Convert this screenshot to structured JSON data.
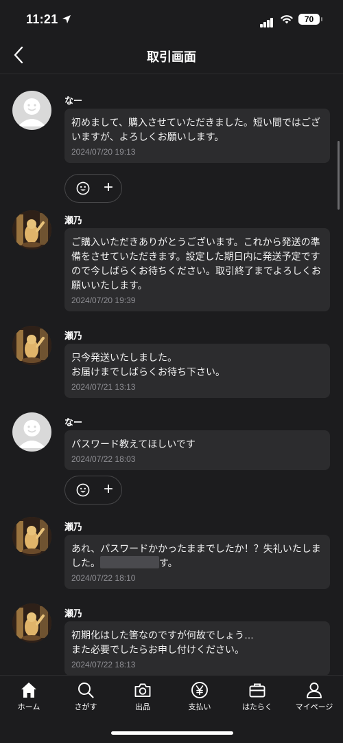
{
  "status_bar": {
    "time": "11:21",
    "battery": "70"
  },
  "header": {
    "title": "取引画面"
  },
  "messages": [
    {
      "sender": "なー",
      "avatar": "default-avatar",
      "text": "初めまして、購入させていただきました。短い間ではございますが、よろしくお願いします。",
      "timestamp": "2024/07/20 19:13"
    },
    {
      "sender": "瀬乃",
      "avatar": "photo-avatar",
      "text": "ご購入いただきありがとうございます。これから発送の準備をさせていただきます。設定した期日内に発送予定ですので今しばらくお待ちください。取引終了までよろしくお願いいたします。",
      "timestamp": "2024/07/20 19:39"
    },
    {
      "sender": "瀬乃",
      "avatar": "photo-avatar",
      "text": "只今発送いたしました。\nお届けまでしばらくお待ち下さい。",
      "timestamp": "2024/07/21 13:13"
    },
    {
      "sender": "なー",
      "avatar": "default-avatar",
      "text": "パスワード教えてほしいです",
      "timestamp": "2024/07/22 18:03"
    },
    {
      "sender": "瀬乃",
      "avatar": "photo-avatar",
      "text_before": "あれ、パスワードかかったままでしたか！？失礼いたしました。",
      "text_after": "す。",
      "timestamp": "2024/07/22 18:10"
    },
    {
      "sender": "瀬乃",
      "avatar": "photo-avatar",
      "text": "初期化はした筈なのですが何故でしょう…\nまた必要でしたらお申し付けください。",
      "timestamp": "2024/07/22 18:13"
    }
  ],
  "reactions": {
    "emoji_icon": "smiley-icon",
    "add_icon": "plus-icon",
    "add_symbol": "+"
  },
  "bottom_nav": [
    {
      "label": "ホーム",
      "icon": "home-icon"
    },
    {
      "label": "さがす",
      "icon": "search-icon"
    },
    {
      "label": "出品",
      "icon": "camera-icon"
    },
    {
      "label": "支払い",
      "icon": "yen-icon"
    },
    {
      "label": "はたらく",
      "icon": "briefcase-icon"
    },
    {
      "label": "マイページ",
      "icon": "person-icon"
    }
  ]
}
